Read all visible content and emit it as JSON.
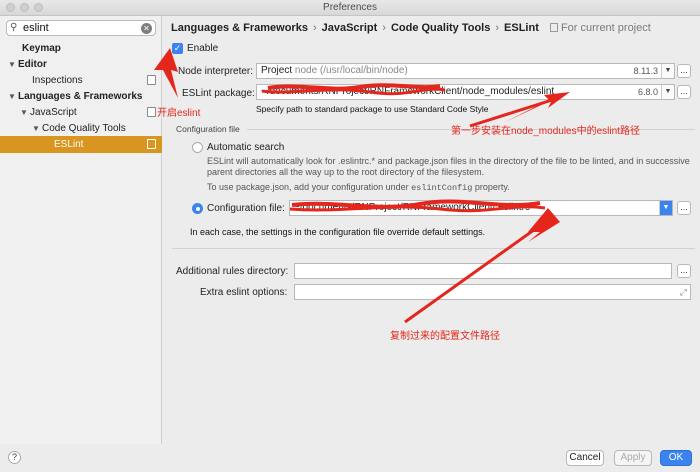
{
  "window": {
    "title": "Preferences"
  },
  "sidebar": {
    "search_value": "eslint",
    "items": [
      {
        "label": "Keymap"
      },
      {
        "label": "Editor"
      },
      {
        "label": "Inspections"
      },
      {
        "label": "Languages & Frameworks"
      },
      {
        "label": "JavaScript"
      },
      {
        "label": "Code Quality Tools"
      },
      {
        "label": "ESLint"
      }
    ],
    "accent_color": "#d89520"
  },
  "breadcrumb": {
    "items": [
      "Languages & Frameworks",
      "JavaScript",
      "Code Quality Tools",
      "ESLint"
    ],
    "scope": "For current project"
  },
  "settings": {
    "enable_label": "Enable",
    "node_interpreter_label": "Node interpreter:",
    "node_interpreter_value": "Project",
    "node_interpreter_path": "node (/usr/local/bin/node)",
    "node_interpreter_version": "8.11.3",
    "eslint_package_label": "ESLint package:",
    "eslint_package_value": "~/documents/RNProject/RNFrameworkClient/node_modules/eslint",
    "eslint_package_version": "6.8.0",
    "eslint_package_hint": "Specify path to standard package to use Standard Code Style",
    "config_section_label": "Configuration file",
    "auto_search_label": "Automatic search",
    "auto_search_desc1": "ESLint will automatically look for .eslintrc.* and package.json files in the directory of the file to be linted, and in successive",
    "auto_search_desc2": "parent directories all the way up to the root directory of the filesystem.",
    "use_pkg_prefix": "To use package.json, add your configuration under",
    "use_pkg_code": "eslintConfig",
    "use_pkg_suffix": "property.",
    "config_file_label": "Configuration file:",
    "config_file_value": "~/documents/RNProject/RNFrameworkClient/.eslintrc",
    "override_note": "In each case, the settings in the configuration file override default settings.",
    "rules_dir_label": "Additional rules directory:",
    "extra_options_label": "Extra eslint options:",
    "accent_color": "#3b84f0"
  },
  "footer": {
    "help_label": "?",
    "cancel_label": "Cancel",
    "apply_label": "Apply",
    "ok_label": "OK"
  },
  "annotations": {
    "enable_note": "开启eslint",
    "step1_note": "第一步安装在node_modules中的eslint路径",
    "copy_note": "复制过来的配置文件路径",
    "color": "#e5261c"
  }
}
